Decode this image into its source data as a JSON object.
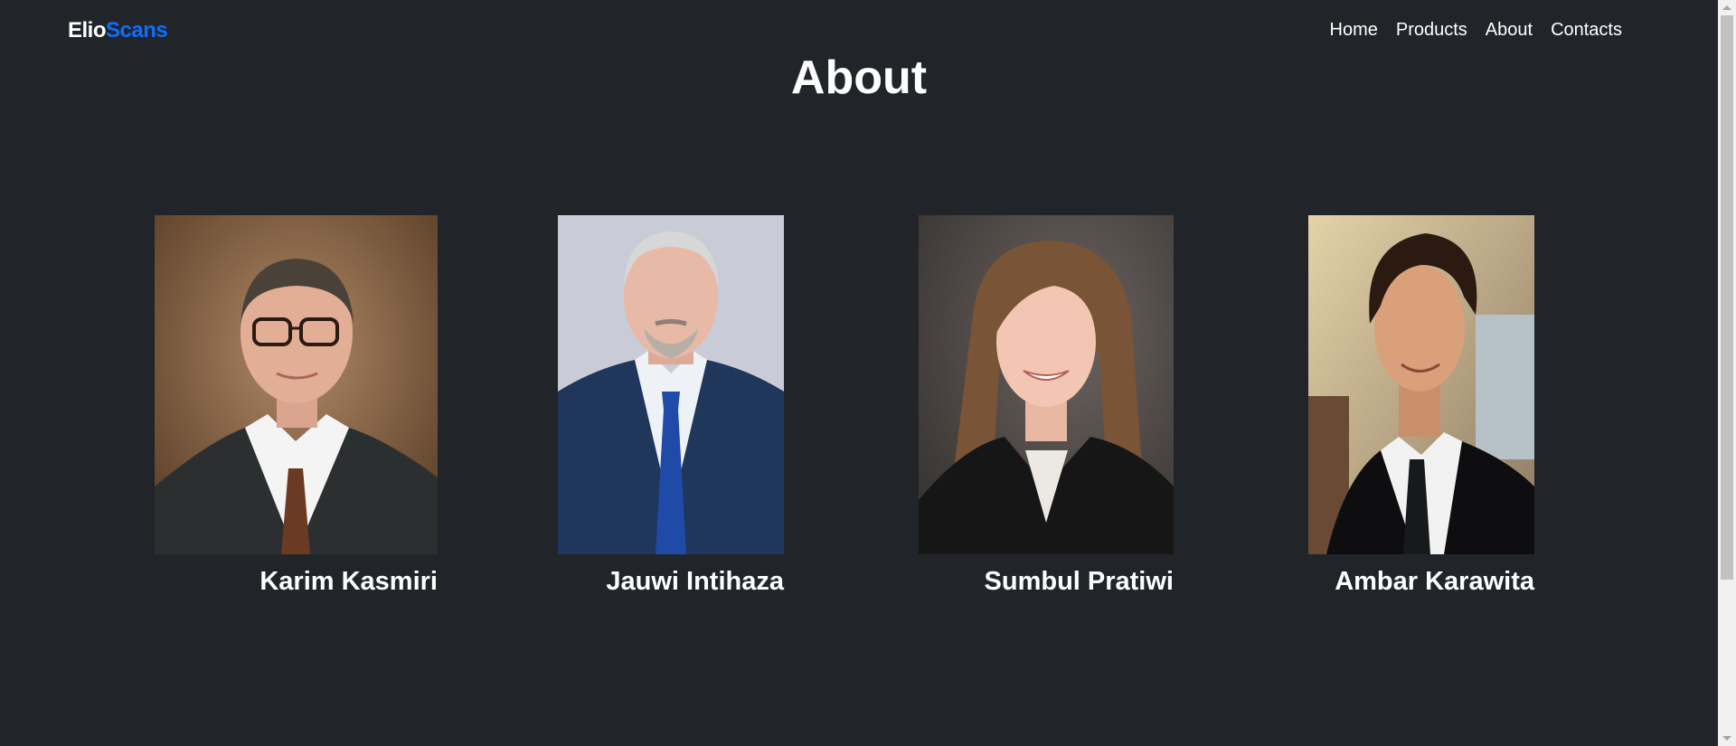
{
  "brand": {
    "part1": "Elio",
    "part2": "Scans"
  },
  "nav": {
    "items": [
      {
        "label": "Home"
      },
      {
        "label": "Products"
      },
      {
        "label": "About"
      },
      {
        "label": "Contacts"
      }
    ]
  },
  "page": {
    "title": "About"
  },
  "team": [
    {
      "name": "Karim Kasmiri"
    },
    {
      "name": "Jauwi Intihaza"
    },
    {
      "name": "Sumbul Pratiwi"
    },
    {
      "name": "Ambar Karawita"
    }
  ],
  "colors": {
    "background": "#212529",
    "accent": "#0d6efd",
    "text": "#ffffff"
  }
}
